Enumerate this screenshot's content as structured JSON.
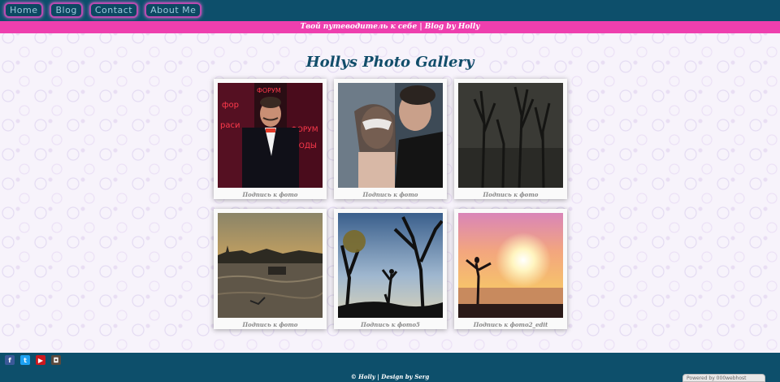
{
  "nav": {
    "items": [
      {
        "label": "Home"
      },
      {
        "label": "Blog"
      },
      {
        "label": "Contact"
      },
      {
        "label": "About Me"
      }
    ]
  },
  "tagline": "Твой путеводитель к себе | Blog by Holly",
  "gallery": {
    "title": "Hollys Photo Gallery",
    "photos": [
      {
        "caption": "Подпись к фото"
      },
      {
        "caption": "Подпись к фото"
      },
      {
        "caption": "Подпись к фото"
      },
      {
        "caption": "Подпись к фото"
      },
      {
        "caption": "Подпись к фото5"
      },
      {
        "caption": "Подпись к фото2_edit"
      }
    ]
  },
  "footer": {
    "text": "© Holly | Design by Serg",
    "social": [
      {
        "icon": "facebook-icon",
        "glyph": "f",
        "color": "#3b5998"
      },
      {
        "icon": "twitter-icon",
        "glyph": "t",
        "color": "#1da1f2"
      },
      {
        "icon": "youtube-icon",
        "glyph": "▶",
        "color": "#cc181e"
      },
      {
        "icon": "instagram-icon",
        "glyph": "◘",
        "color": "#5b4a3d"
      }
    ],
    "powered": "Powered by  000webhost"
  },
  "colors": {
    "nav_bg": "#0d4f6b",
    "accent_pink": "#ee3fae",
    "title": "#114d6a"
  }
}
